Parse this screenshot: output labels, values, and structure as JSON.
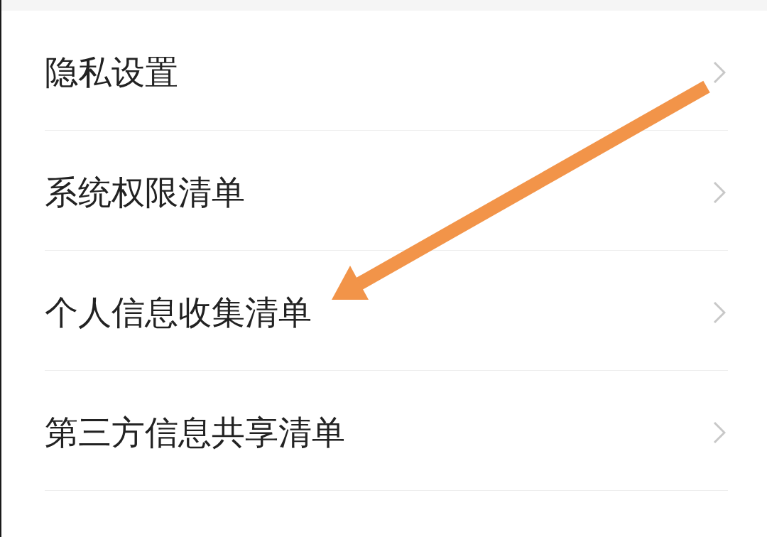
{
  "settings_list": [
    {
      "label": "隐私设置"
    },
    {
      "label": "系统权限清单"
    },
    {
      "label": "个人信息收集清单"
    },
    {
      "label": "第三方信息共享清单"
    }
  ]
}
